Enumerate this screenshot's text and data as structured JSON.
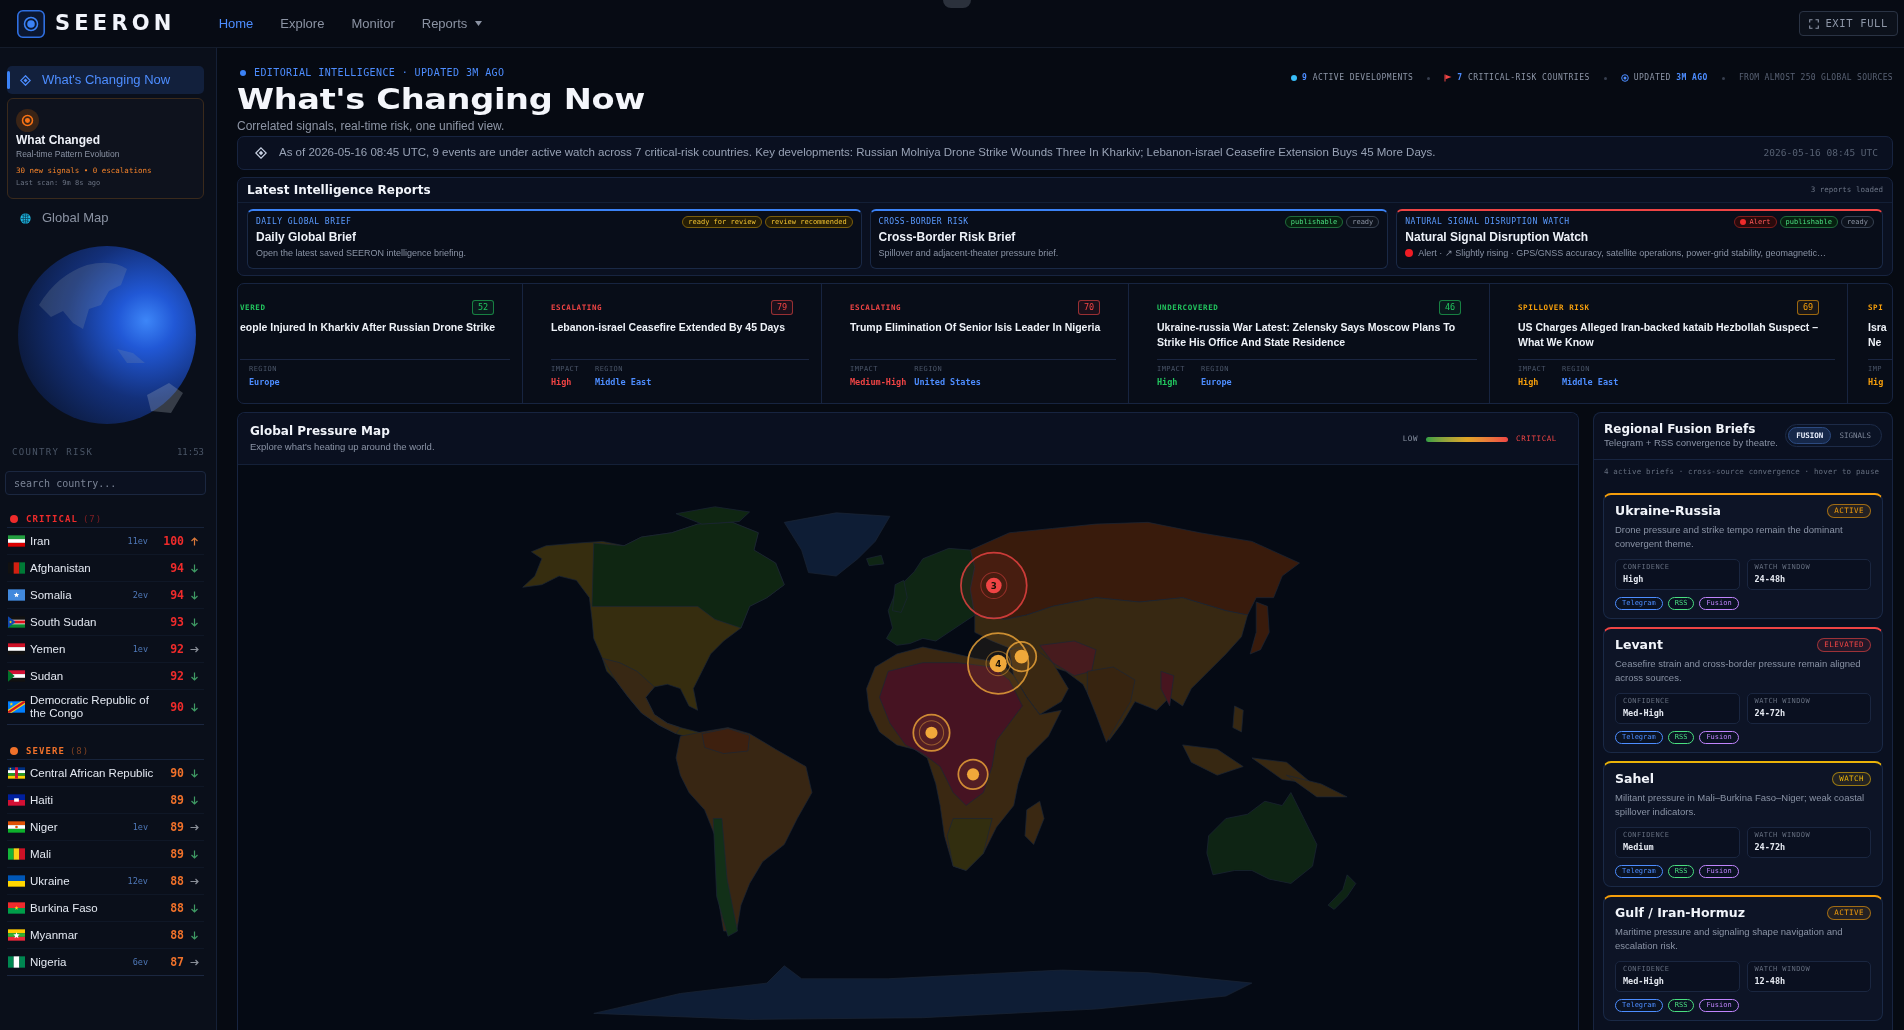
{
  "nav": {
    "brand": "SEERON",
    "links": [
      {
        "label": "Home",
        "selected": true,
        "dropdown": false
      },
      {
        "label": "Explore",
        "selected": false,
        "dropdown": false
      },
      {
        "label": "Monitor",
        "selected": false,
        "dropdown": false
      },
      {
        "label": "Reports",
        "selected": false,
        "dropdown": true
      }
    ],
    "exit_button": "EXIT FULL"
  },
  "sidebar": {
    "items": [
      {
        "kind": "link",
        "label": "What's Changing Now",
        "selected": true
      },
      {
        "kind": "card",
        "title": "What Changed",
        "subtitle": "Real-time Pattern Evolution",
        "stats": "30 new signals • 0 escalations",
        "last_scan": "Last scan: 9m 8s ago"
      },
      {
        "kind": "link",
        "label": "Global Map",
        "selected": false
      }
    ]
  },
  "country_risk": {
    "title": "COUNTRY RISK",
    "time": "11:53",
    "search_placeholder": "search country...",
    "groups": [
      {
        "label": "CRITICAL",
        "count": "(7)",
        "color": "#ef2b2b",
        "countries": [
          {
            "name": "Iran",
            "events": "11ev",
            "score": "100",
            "kind": "rising"
          },
          {
            "name": "Afghanistan",
            "score": "94",
            "kind": "falling"
          },
          {
            "name": "Somalia",
            "events": "2ev",
            "score": "94",
            "kind": "falling"
          },
          {
            "name": "South Sudan",
            "score": "93",
            "kind": "falling"
          },
          {
            "name": "Yemen",
            "events": "1ev",
            "score": "92",
            "kind": "steady"
          },
          {
            "name": "Sudan",
            "score": "92",
            "kind": "falling"
          },
          {
            "name": "Democratic Republic of the Congo",
            "score": "90",
            "kind": "falling"
          }
        ]
      },
      {
        "label": "SEVERE",
        "count": "(8)",
        "color": "#f0712a",
        "countries": [
          {
            "name": "Central African Republic",
            "score": "90",
            "kind": "falling"
          },
          {
            "name": "Haiti",
            "score": "89",
            "kind": "falling"
          },
          {
            "name": "Niger",
            "events": "1ev",
            "score": "89",
            "kind": "steady"
          },
          {
            "name": "Mali",
            "score": "89",
            "kind": "falling"
          },
          {
            "name": "Ukraine",
            "events": "12ev",
            "score": "88",
            "kind": "steady"
          },
          {
            "name": "Burkina Faso",
            "score": "88",
            "kind": "falling"
          },
          {
            "name": "Myanmar",
            "score": "88",
            "kind": "falling"
          },
          {
            "name": "Nigeria",
            "events": "6ev",
            "score": "87",
            "kind": "steady"
          }
        ]
      }
    ]
  },
  "header": {
    "eyebrow": "EDITORIAL INTELLIGENCE · UPDATED 3M AGO",
    "title": "What's Changing Now",
    "subtitle": "Correlated signals, real-time risk, one unified view.",
    "stats": [
      {
        "kind": "dot",
        "text": "**9** ACTIVE DEVELOPMENTS"
      },
      {
        "kind": "flag",
        "text": "**7** CRITICAL-RISK COUNTRIES"
      },
      {
        "kind": "clock",
        "text": "UPDATED **3M AGO**"
      },
      {
        "kind": "plain",
        "text": "FROM ALMOST 250 GLOBAL SOURCES"
      }
    ]
  },
  "summary": {
    "text": "As of 2026-05-16 08:45 UTC, 9 events are under active watch across 7 critical-risk countries. Key developments: Russian Molniya Drone Strike Wounds Three In Kharkiv; Lebanon-israel Ceasefire Extension Buys 45 More Days.",
    "timestamp": "2026-05-16 08:45 UTC"
  },
  "reports": {
    "title": "Latest Intelligence Reports",
    "count": "3 reports loaded",
    "cards": [
      {
        "category": "DAILY GLOBAL BRIEF",
        "title": "Daily Global Brief",
        "description": "Open the latest saved SEERON intelligence briefing.",
        "color": "#3b82f6",
        "alert": false,
        "badges": [
          {
            "label": "ready for review",
            "kind": "warning"
          },
          {
            "label": "review recommended",
            "kind": "warning"
          }
        ]
      },
      {
        "category": "CROSS-BORDER RISK",
        "title": "Cross-Border Risk Brief",
        "description": "Spillover and adjacent-theater pressure brief.",
        "color": "#3b82f6",
        "alert": false,
        "badges": [
          {
            "label": "publishable",
            "kind": "success"
          },
          {
            "label": "ready",
            "kind": "neutral"
          }
        ]
      },
      {
        "category": "NATURAL SIGNAL DISRUPTION WATCH",
        "title": "Natural Signal Disruption Watch",
        "description": "Alert · ↗ Slightly rising · GPS/GNSS accuracy, satellite operations, power-grid stability, geomagnetic…",
        "color": "#ef4444",
        "alert": true,
        "badges": [
          {
            "label": "Alert",
            "kind": "alert"
          },
          {
            "label": "publishable",
            "kind": "success"
          },
          {
            "label": "ready",
            "kind": "neutral"
          }
        ]
      }
    ]
  },
  "events": [
    {
      "status": "VERED",
      "score": "52",
      "title": "eople Injured In Kharkiv After Russian Drone Strike",
      "region_label": "REGION",
      "region": "Europe",
      "color": "#22c55e"
    },
    {
      "status": "ESCALATING",
      "score": "79",
      "title": "Lebanon-israel Ceasefire Extended By 45 Days",
      "impact_label": "IMPACT",
      "impact": "High",
      "region_label": "REGION",
      "region": "Middle East",
      "color": "#ef4444"
    },
    {
      "status": "ESCALATING",
      "score": "70",
      "title": "Trump Elimination Of Senior Isis Leader In Nigeria",
      "impact_label": "IMPACT",
      "impact": "Medium-High",
      "region_label": "REGION",
      "region": "United States",
      "color": "#ef4444"
    },
    {
      "status": "UNDERCOVERED",
      "score": "46",
      "title": "Ukraine-russia War Latest: Zelensky Says Moscow Plans To Strike His Office And State Residence",
      "impact_label": "IMPACT",
      "impact": "High",
      "region_label": "REGION",
      "region": "Europe",
      "color": "#22c55e"
    },
    {
      "status": "SPILLOVER RISK",
      "score": "69",
      "title": "US Charges Alleged Iran-backed kataib Hezbollah Suspect – What We Know",
      "impact_label": "IMPACT",
      "impact": "High",
      "region_label": "REGION",
      "region": "Middle East",
      "color": "#f59e0b"
    },
    {
      "status": "SPI",
      "title": "Isra Ne",
      "impact_label": "IMP",
      "impact": "Hig",
      "color": "#f59e0b"
    }
  ],
  "map": {
    "title": "Global Pressure Map",
    "subtitle": "Explore what's heating up around the world.",
    "legend": {
      "low": "LOW",
      "high": "CRITICAL"
    },
    "markers": [
      {
        "count": "3",
        "color": "#ef4444"
      },
      {
        "count": "4",
        "color": "#f0a83a"
      },
      {
        "color": "#f0a83a"
      },
      {
        "color": "#f0a83a"
      },
      {
        "color": "#f0a83a"
      }
    ]
  },
  "fusion": {
    "title": "Regional Fusion Briefs",
    "subtitle": "Telegram + RSS convergence by theatre.",
    "tabs": [
      {
        "label": "FUSION",
        "selected": true
      },
      {
        "label": "SIGNALS",
        "selected": false
      }
    ],
    "info": "4 active briefs · cross-source convergence · hover to pause",
    "briefs": [
      {
        "title": "Ukraine-Russia",
        "status": "ACTIVE",
        "color": "#f59e0b",
        "description": "Drone pressure and strike tempo remain the dominant convergent theme.",
        "metrics": [
          {
            "label": "CONFIDENCE",
            "value": "High"
          },
          {
            "label": "WATCH WINDOW",
            "value": "24-48h"
          }
        ],
        "tags": [
          {
            "label": "Telegram",
            "color": "#4d8dff"
          },
          {
            "label": "RSS",
            "color": "#4ade80"
          },
          {
            "label": "Fusion",
            "color": "#c084fc"
          }
        ]
      },
      {
        "title": "Levant",
        "status": "ELEVATED",
        "color": "#ef4444",
        "description": "Ceasefire strain and cross-border pressure remain aligned across sources.",
        "metrics": [
          {
            "label": "CONFIDENCE",
            "value": "Med-High"
          },
          {
            "label": "WATCH WINDOW",
            "value": "24-72h"
          }
        ],
        "tags": [
          {
            "label": "Telegram",
            "color": "#4d8dff"
          },
          {
            "label": "RSS",
            "color": "#4ade80"
          },
          {
            "label": "Fusion",
            "color": "#c084fc"
          }
        ]
      },
      {
        "title": "Sahel",
        "status": "WATCH",
        "color": "#eab308",
        "description": "Militant pressure in Mali–Burkina Faso–Niger; weak coastal spillover indicators.",
        "metrics": [
          {
            "label": "CONFIDENCE",
            "value": "Medium"
          },
          {
            "label": "WATCH WINDOW",
            "value": "24-72h"
          }
        ],
        "tags": [
          {
            "label": "Telegram",
            "color": "#4d8dff"
          },
          {
            "label": "RSS",
            "color": "#4ade80"
          },
          {
            "label": "Fusion",
            "color": "#c084fc"
          }
        ]
      },
      {
        "title": "Gulf / Iran-Hormuz",
        "status": "ACTIVE",
        "color": "#f59e0b",
        "description": "Maritime pressure and signaling shape navigation and escalation risk.",
        "metrics": [
          {
            "label": "CONFIDENCE",
            "value": "Med-High"
          },
          {
            "label": "WATCH WINDOW",
            "value": "12-48h"
          }
        ],
        "tags": [
          {
            "label": "Telegram",
            "color": "#4d8dff"
          },
          {
            "label": "RSS",
            "color": "#4ade80"
          },
          {
            "label": "Fusion",
            "color": "#c084fc"
          }
        ]
      }
    ]
  }
}
